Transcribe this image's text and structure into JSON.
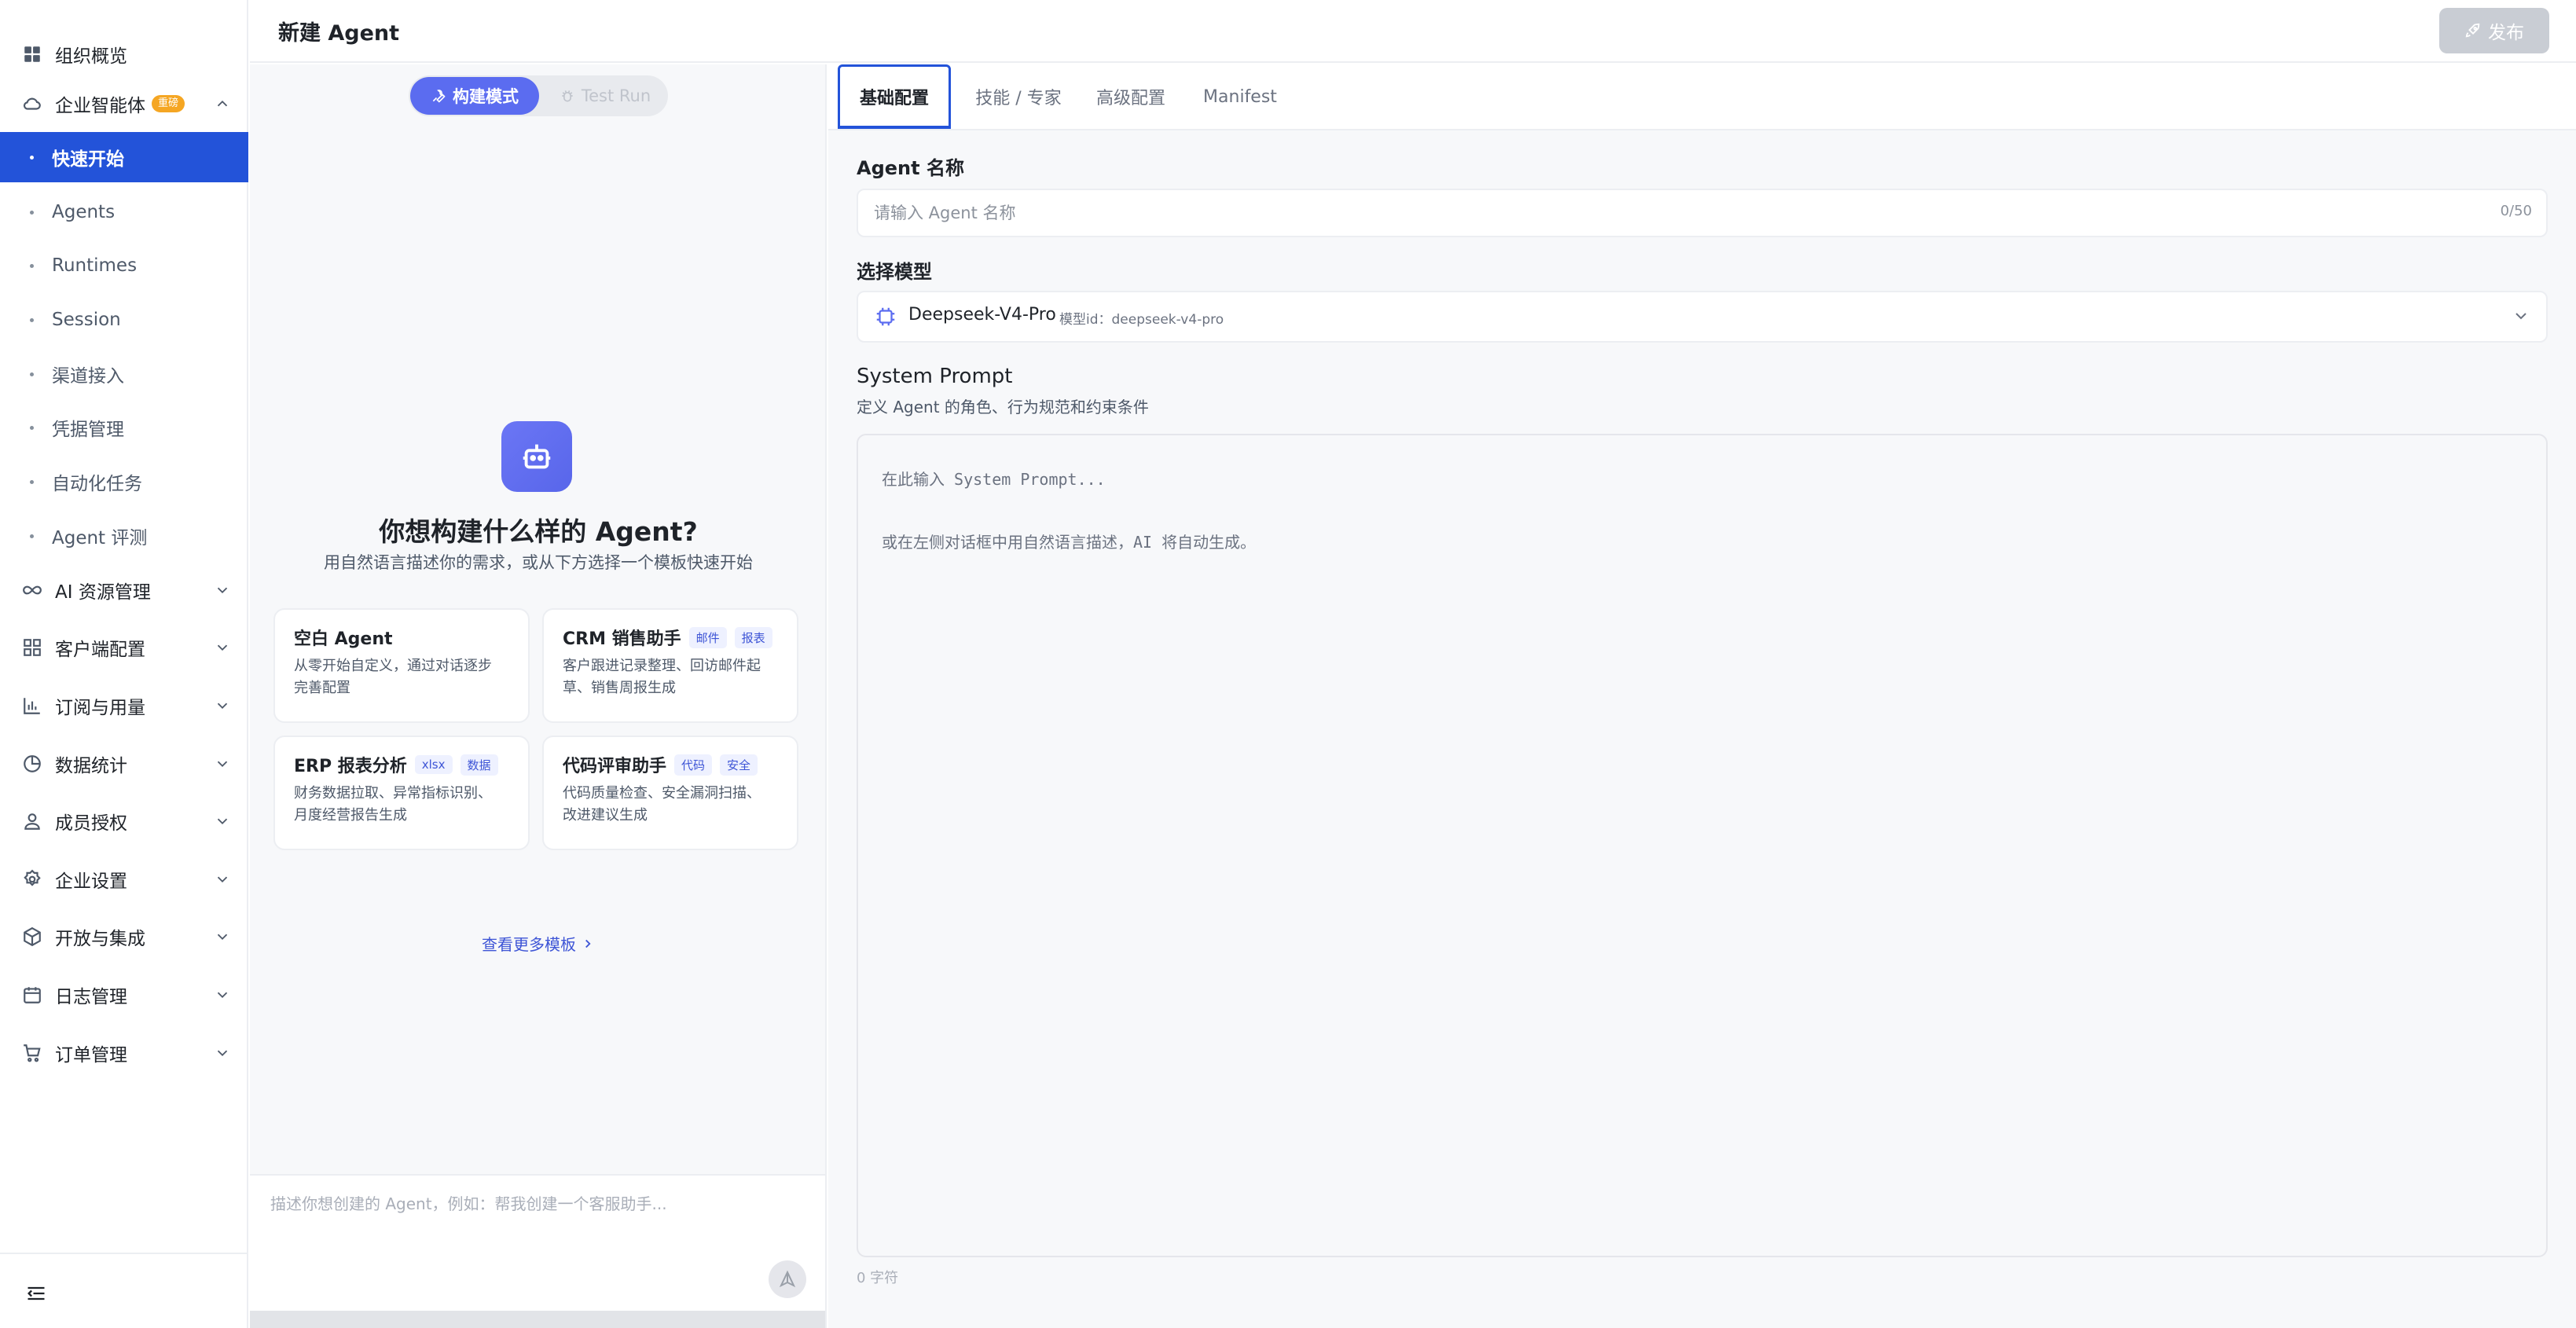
{
  "header": {
    "title": "新建 Agent",
    "publish_label": "发布"
  },
  "sidebar": {
    "top_item": {
      "label": "组织概览",
      "icon": "grid-icon"
    },
    "groups": [
      {
        "label": "企业智能体",
        "icon": "cloud-icon",
        "badge": "重磅",
        "expanded": true
      },
      {
        "label": "AI 资源管理",
        "icon": "infinity-icon"
      },
      {
        "label": "客户端配置",
        "icon": "apps-icon"
      },
      {
        "label": "订阅与用量",
        "icon": "bar-chart-icon"
      },
      {
        "label": "数据统计",
        "icon": "pie-chart-icon"
      },
      {
        "label": "成员授权",
        "icon": "user-icon"
      },
      {
        "label": "企业设置",
        "icon": "settings-icon"
      },
      {
        "label": "开放与集成",
        "icon": "cube-icon"
      },
      {
        "label": "日志管理",
        "icon": "calendar-icon"
      },
      {
        "label": "订单管理",
        "icon": "cart-icon"
      }
    ],
    "sub_items": [
      {
        "label": "快速开始",
        "active": true
      },
      {
        "label": "Agents"
      },
      {
        "label": "Runtimes"
      },
      {
        "label": "Session"
      },
      {
        "label": "渠道接入"
      },
      {
        "label": "凭据管理"
      },
      {
        "label": "自动化任务"
      },
      {
        "label": "Agent 评测"
      }
    ]
  },
  "chat": {
    "mode_build": "构建模式",
    "mode_test": "Test Run",
    "hero_title": "你想构建什么样的 Agent?",
    "hero_subtitle": "用自然语言描述你的需求，或从下方选择一个模板快速开始",
    "templates": [
      {
        "title": "空白 Agent",
        "tags": [],
        "desc": [
          "从零开始自定义，通过对话逐步",
          "完善配置"
        ]
      },
      {
        "title": "CRM 销售助手",
        "tags": [
          "邮件",
          "报表"
        ],
        "desc": [
          "客户跟进记录整理、回访邮件起",
          "草、销售周报生成"
        ]
      },
      {
        "title": "ERP 报表分析",
        "tags": [
          "xlsx",
          "数据"
        ],
        "desc": [
          "财务数据拉取、异常指标识别、",
          "月度经营报告生成"
        ]
      },
      {
        "title": "代码评审助手",
        "tags": [
          "代码",
          "安全"
        ],
        "desc": [
          "代码质量检查、安全漏洞扫描、",
          "改进建议生成"
        ]
      }
    ],
    "more_templates": "查看更多模板",
    "input_placeholder": "描述你想创建的 Agent，例如：帮我创建一个客服助手..."
  },
  "config": {
    "tabs": [
      {
        "label": "基础配置",
        "active": true
      },
      {
        "label": "技能 / 专家"
      },
      {
        "label": "高级配置"
      },
      {
        "label": "Manifest"
      }
    ],
    "name": {
      "label": "Agent 名称",
      "placeholder": "请输入 Agent 名称",
      "value": "",
      "count": "0/50"
    },
    "model": {
      "label": "选择模型",
      "name": "Deepseek-V4-Pro",
      "id_text": "模型id：deepseek-v4-pro"
    },
    "prompt": {
      "label": "System Prompt",
      "hint": "定义 Agent 的角色、行为规范和约束条件",
      "placeholder": "在此输入 System Prompt...\n\n或在左侧对话框中用自然语言描述，AI 将自动生成。",
      "value": "",
      "char_count": "0 字符"
    }
  },
  "colors": {
    "accent": "#2353d9",
    "build_mode": "#5b6cf0",
    "tag_bg": "#eef1ff",
    "tag_text": "#3e55d6",
    "badge": "#f5a623"
  }
}
